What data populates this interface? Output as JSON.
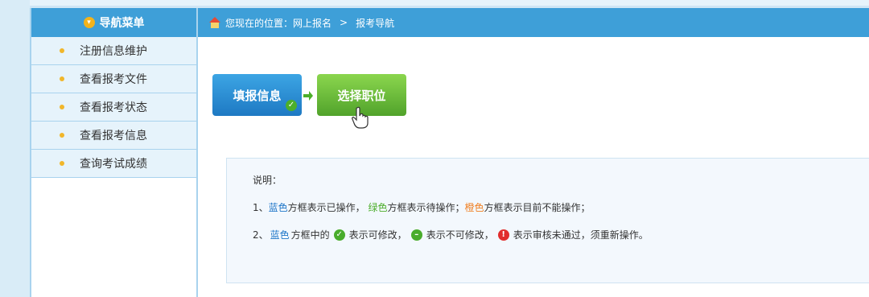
{
  "sidebar": {
    "title": "导航菜单",
    "items": [
      {
        "label": "注册信息维护"
      },
      {
        "label": "查看报考文件"
      },
      {
        "label": "查看报考状态"
      },
      {
        "label": "查看报考信息"
      },
      {
        "label": "查询考试成绩"
      }
    ]
  },
  "breadcrumb": {
    "prefix": "您现在的位置：网上报名",
    "separator": ">",
    "current": "报考导航"
  },
  "steps": {
    "fill_info": "填报信息",
    "select_position": "选择职位"
  },
  "notes": {
    "title": "说明：",
    "line1": {
      "prefix": "1、",
      "blue": "蓝色",
      "blue_desc": "方框表示已操作，",
      "green": "绿色",
      "green_desc": "方框表示待操作；",
      "orange": "橙色",
      "orange_desc": "方框表示目前不能操作；"
    },
    "line2": {
      "prefix": "2、",
      "blue": "蓝色",
      "blue_desc": "方框中的",
      "check_desc": "表示可修改，",
      "minus_desc": "表示不可修改，",
      "warn_desc": "表示审核未通过，须重新操作。"
    }
  },
  "colors": {
    "header_blue": "#3e9fd8",
    "step_blue": "#1e79c3",
    "step_green": "#51a32b",
    "text_blue": "#2178c9",
    "text_green": "#4eae2d",
    "text_orange": "#f07f22"
  }
}
